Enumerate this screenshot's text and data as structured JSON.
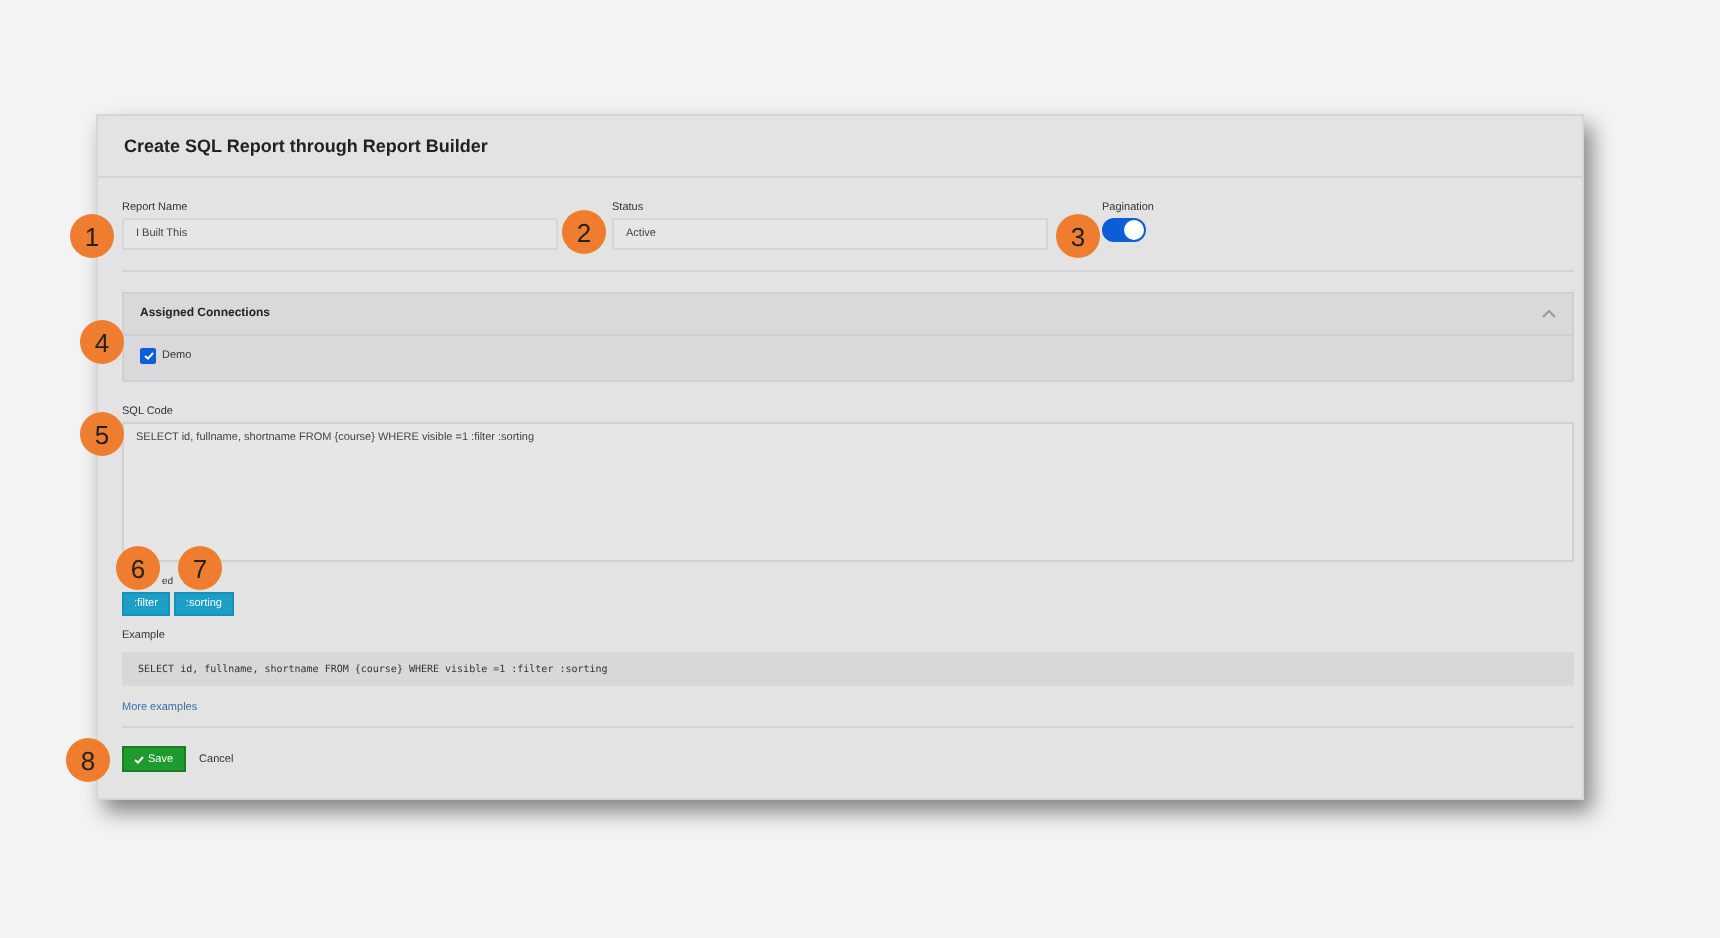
{
  "title": "Create SQL Report through Report Builder",
  "fields": [
    {
      "label": "Report Name",
      "value": "I Built This"
    },
    {
      "label": "Status",
      "value": "Active"
    }
  ],
  "pagination": {
    "label": "Pagination",
    "on": true
  },
  "connections": {
    "title": "Assigned Connections",
    "expanded": true,
    "items": [
      {
        "label": "Demo",
        "checked": true
      }
    ]
  },
  "sql": {
    "label": "SQL Code",
    "value": "SELECT id, fullname, shortname FROM {course} WHERE visible =1 :filter :sorting"
  },
  "placeholders": {
    "label_fragment": "ed",
    "tags": [
      ":filter",
      ":sorting"
    ]
  },
  "example": {
    "label": "Example",
    "code": "SELECT id, fullname, shortname FROM {course} WHERE visible =1 :filter :sorting",
    "link": "More examples"
  },
  "actions": {
    "save": "Save",
    "cancel": "Cancel"
  },
  "callouts": [
    "1",
    "2",
    "3",
    "4",
    "5",
    "6",
    "7",
    "8"
  ]
}
